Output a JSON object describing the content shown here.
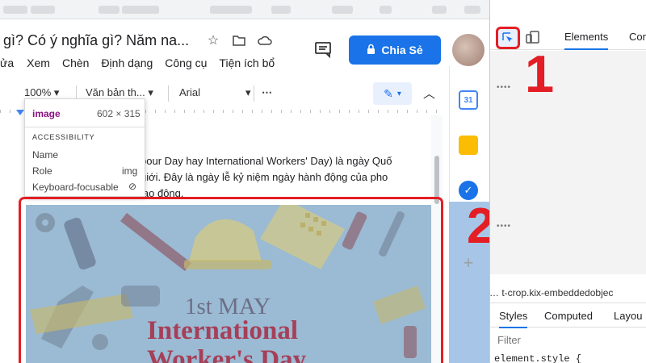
{
  "docs": {
    "title": "gì? Có ý nghĩa gì? Năm na...",
    "menu": [
      "ửa",
      "Xem",
      "Chèn",
      "Định dạng",
      "Công cụ",
      "Tiện ích bổ"
    ],
    "share_label": "Chia Sẻ",
    "toolbar": {
      "zoom": "100%",
      "style": "Văn bản th...",
      "font": "Arial",
      "more": "⋯"
    },
    "body_text": [
      "bour Day hay International Workers' Day) là ngày Quố",
      "giới. Đây là ngày lễ kỷ niệm ngày hành động của pho",
      "lạo động."
    ],
    "image_text": {
      "small": "1st MAY",
      "large": "International",
      "large2": "Worker's Day"
    }
  },
  "tooltip": {
    "tag": "image",
    "dims": "602 × 315",
    "section": "ACCESSIBILITY",
    "rows": [
      {
        "k": "Name",
        "v": ""
      },
      {
        "k": "Role",
        "v": "img"
      },
      {
        "k": "Keyboard-focusable",
        "v": "⊘"
      }
    ]
  },
  "devtools": {
    "tabs": [
      "Elements",
      "Con"
    ],
    "breadcrumb": "…   t-crop.kix-embeddedobjec",
    "bottom_tabs": [
      "Styles",
      "Computed",
      "Layou"
    ],
    "filter_placeholder": "Filter",
    "style_text": "element.style {"
  },
  "annotations": {
    "first": "1",
    "second": "2"
  },
  "colors": {
    "accent_blue": "#1a73e8",
    "highlight_red": "#e31e24"
  }
}
